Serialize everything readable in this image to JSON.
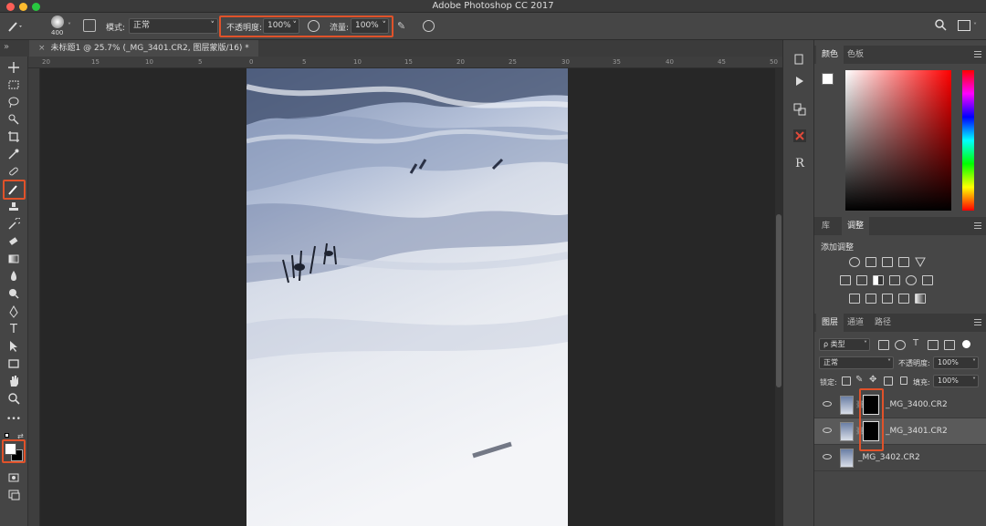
{
  "window": {
    "title": "Adobe Photoshop CC 2017"
  },
  "options_bar": {
    "brush_size": "400",
    "mode_label": "模式:",
    "mode_value": "正常",
    "opacity_label": "不透明度:",
    "opacity_value": "100%",
    "flow_label": "流量:",
    "flow_value": "100%"
  },
  "document_tab": {
    "title": "未标题1 @ 25.7% (_MG_3401.CR2, 图层蒙版/16) *"
  },
  "ruler": {
    "ticks": [
      "20",
      "15",
      "10",
      "5",
      "0",
      "5",
      "10",
      "15",
      "20",
      "25",
      "30",
      "35",
      "40",
      "45",
      "50"
    ]
  },
  "color_panel": {
    "tabs": [
      "颜色",
      "色板"
    ]
  },
  "adjust_panel": {
    "tabs": [
      "库",
      "调整"
    ],
    "add_label": "添加调整"
  },
  "layers_panel": {
    "tabs": [
      "图层",
      "通道",
      "路径"
    ],
    "filter_label": "ρ 类型",
    "blend_mode": "正常",
    "opacity_label": "不透明度:",
    "opacity_value": "100%",
    "lock_label": "锁定:",
    "fill_label": "填充:",
    "fill_value": "100%",
    "layers": [
      {
        "name": "_MG_3400.CR2",
        "has_mask": true,
        "selected": false
      },
      {
        "name": "_MG_3401.CR2",
        "has_mask": true,
        "selected": true
      },
      {
        "name": "_MG_3402.CR2",
        "has_mask": false,
        "selected": false
      }
    ]
  },
  "colors": {
    "accent_highlight": "#e0522a",
    "foreground": "#ffffff",
    "background": "#000000"
  }
}
